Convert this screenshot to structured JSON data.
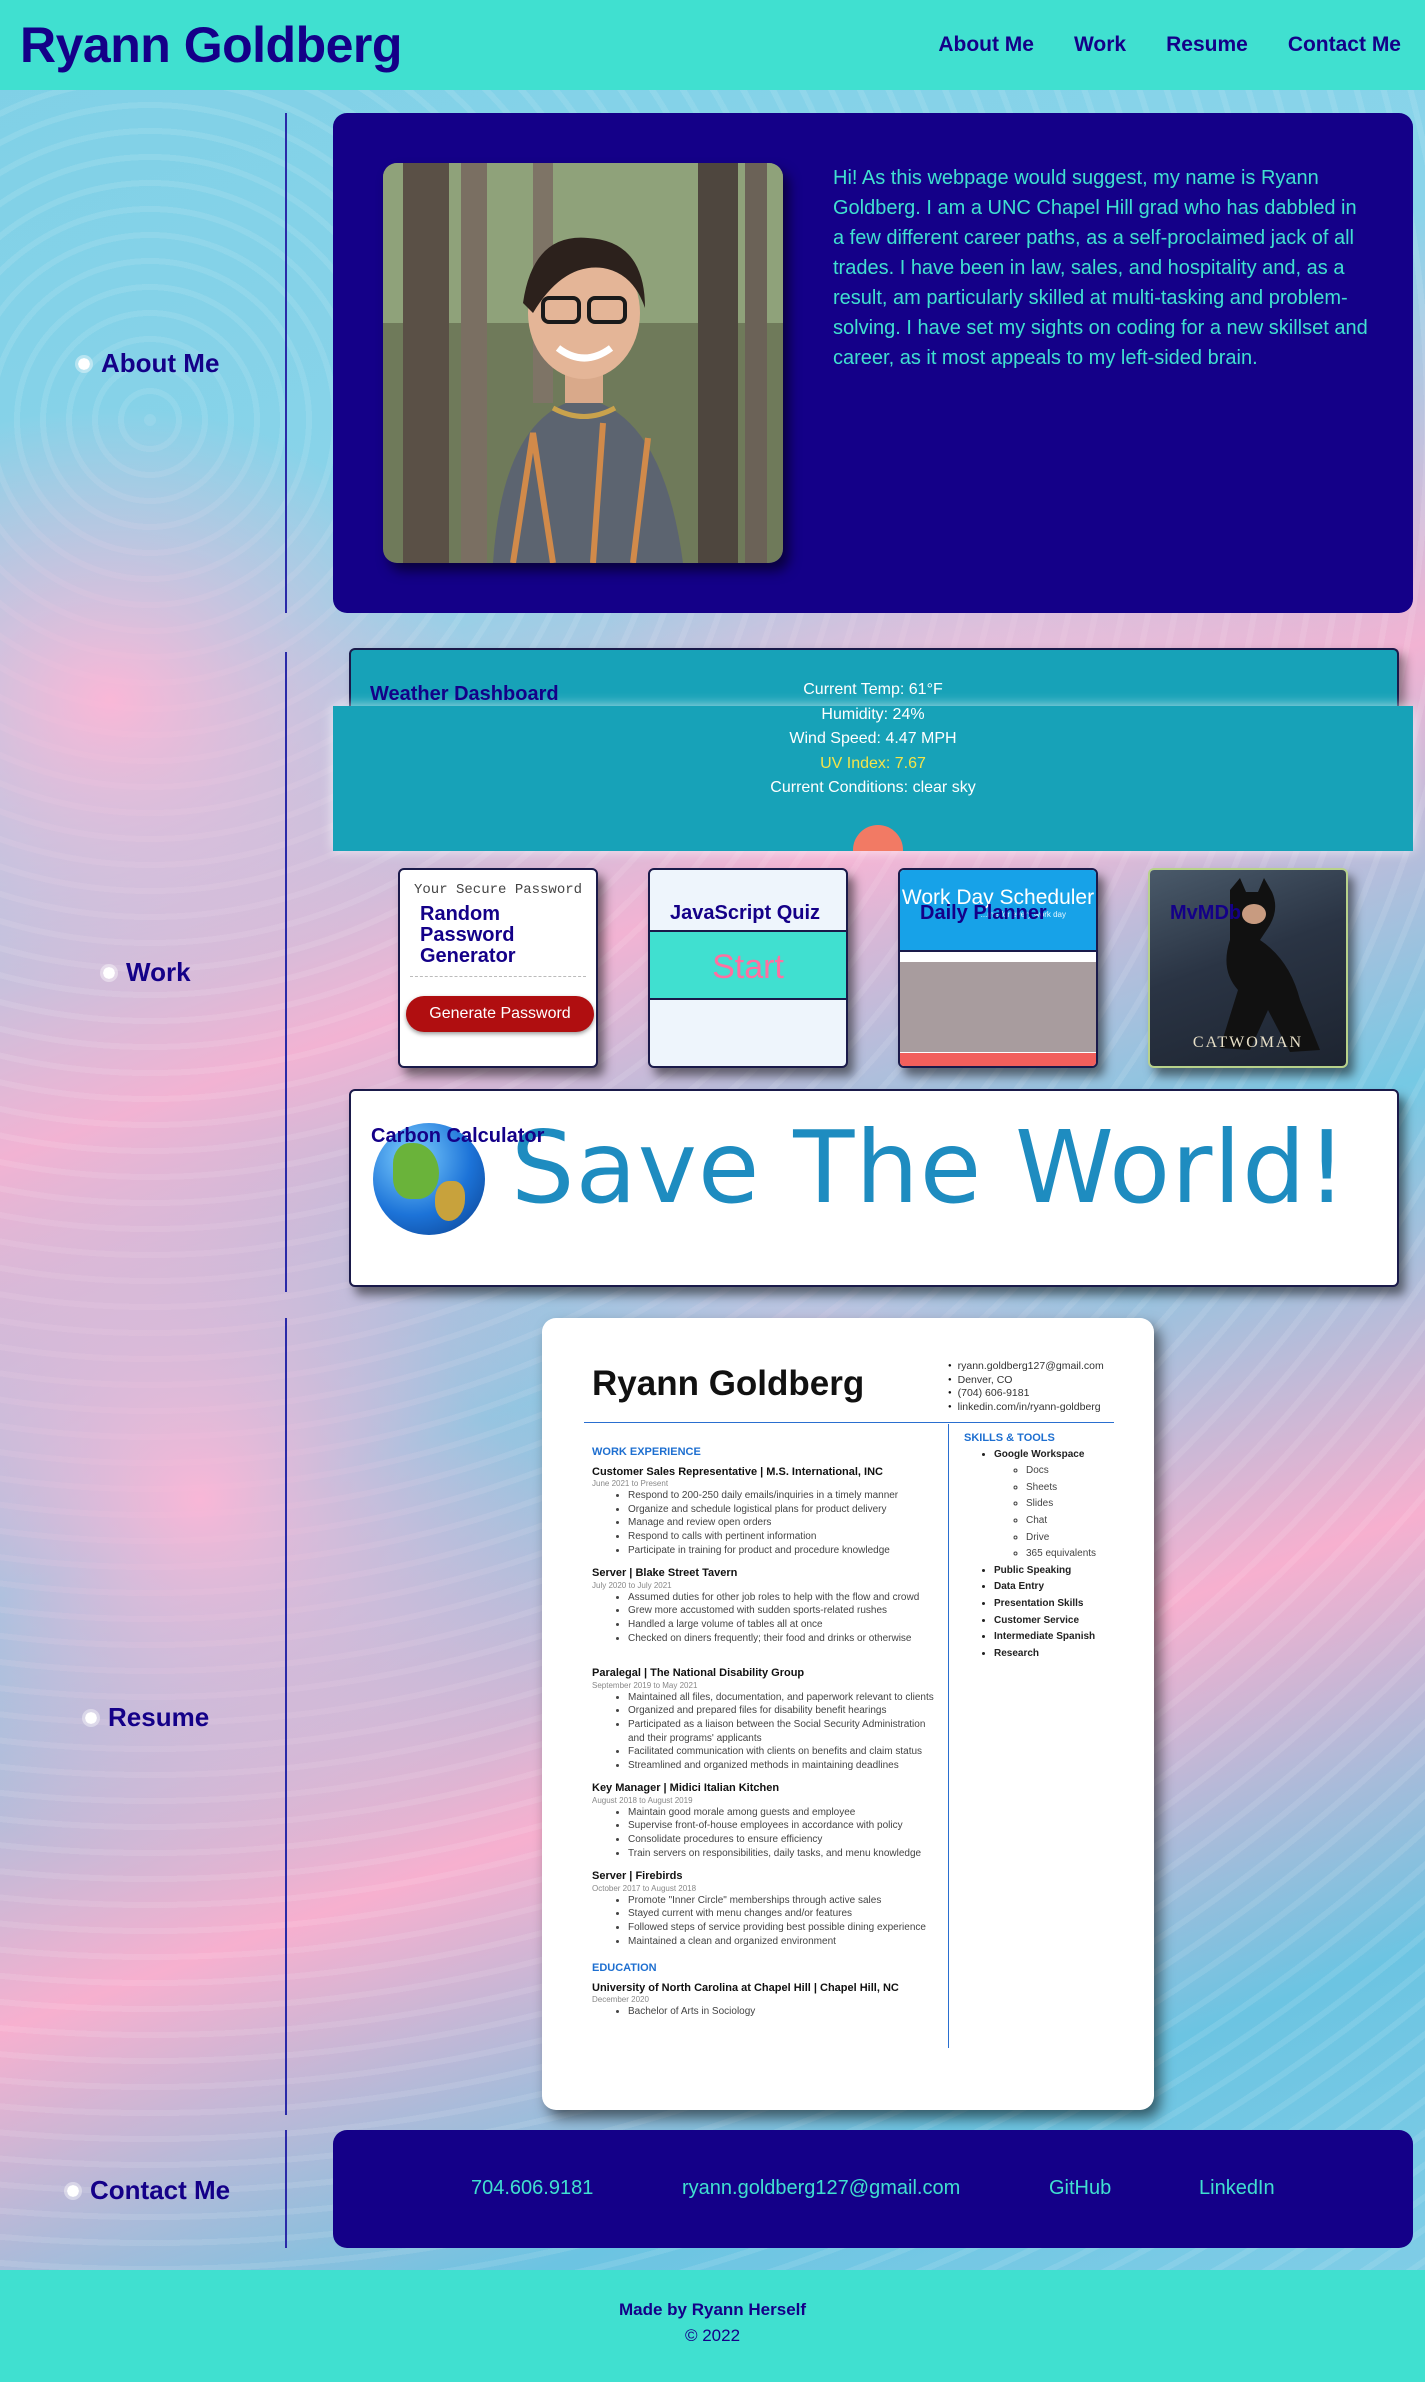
{
  "header": {
    "title": "Ryann Goldberg",
    "nav": [
      "About Me",
      "Work",
      "Resume",
      "Contact Me"
    ]
  },
  "sections": {
    "about": "About Me",
    "work": "Work",
    "resume": "Resume",
    "contact": "Contact Me"
  },
  "about": {
    "bio": "Hi! As this webpage would suggest, my name is Ryann Goldberg. I am a UNC Chapel Hill grad who has dabbled in a few different career paths, as a self-proclaimed jack of all trades. I have been in law, sales, and hospitality and, as a result, am particularly skilled at multi-tasking and problem-solving. I have set my sights on coding for a new skillset and career, as it most appeals to my left-sided brain."
  },
  "work": {
    "weather": {
      "title": "Weather Dashboard",
      "temp": "Current Temp: 61°F",
      "humidity": "Humidity: 24%",
      "wind": "Wind Speed: 4.47 MPH",
      "uv": "UV Index: 7.67",
      "conditions": "Current Conditions: clear sky"
    },
    "password": {
      "header": "Your Secure Password",
      "title": "Random Password Generator",
      "button": "Generate Password"
    },
    "quiz": {
      "title": "JavaScript Quiz",
      "start": "Start"
    },
    "planner": {
      "title": "Daily Planner",
      "banner": "Work Day Scheduler",
      "sub": "...me for every work day"
    },
    "movie": {
      "title": "MvMDb",
      "poster_text": "CATWOMAN"
    },
    "carbon": {
      "title": "Carbon Calculator",
      "slogan": "Save The World!"
    }
  },
  "resume": {
    "name": "Ryann Goldberg",
    "contact": [
      "ryann.goldberg127@gmail.com",
      "Denver, CO",
      "(704) 606-9181",
      "linkedin.com/in/ryann-goldberg"
    ],
    "work_heading": "WORK EXPERIENCE",
    "jobs": [
      {
        "title": "Customer Sales Representative | M.S. International, INC",
        "date": "June 2021 to Present",
        "bullets": [
          "Respond to 200-250 daily emails/inquiries in a timely manner",
          "Organize and schedule logistical plans for product delivery",
          "Manage and review open orders",
          "Respond to calls with pertinent information",
          "Participate in training for product and procedure knowledge"
        ]
      },
      {
        "title": "Server | Blake Street Tavern",
        "date": "July 2020 to July 2021",
        "bullets": [
          "Assumed duties for other job roles to help with the flow and crowd",
          "Grew more accustomed with sudden sports-related rushes",
          "Handled a large volume of tables all at once",
          "Checked on diners frequently; their food and drinks or otherwise"
        ]
      },
      {
        "title": "Paralegal | The National Disability Group",
        "date": "September 2019 to May 2021",
        "bullets": [
          "Maintained all files, documentation, and paperwork relevant to clients",
          "Organized and prepared files for disability benefit hearings",
          "Participated as a liaison between the Social Security Administration and their programs' applicants",
          "Facilitated communication with clients on benefits and claim status",
          "Streamlined and organized methods in maintaining deadlines"
        ]
      },
      {
        "title": "Key Manager | Midici Italian Kitchen",
        "date": "August 2018 to August 2019",
        "bullets": [
          "Maintain good morale among guests and employee",
          "Supervise front-of-house employees in accordance with policy",
          "Consolidate procedures to ensure efficiency",
          "Train servers on responsibilities, daily tasks, and menu knowledge"
        ]
      },
      {
        "title": "Server | Firebirds",
        "date": "October 2017 to August 2018",
        "bullets": [
          "Promote \"Inner Circle\" memberships through active sales",
          "Stayed current with menu changes and/or features",
          "Followed steps of service providing best possible dining experience",
          "Maintained a clean and organized environment"
        ]
      }
    ],
    "edu_heading": "EDUCATION",
    "edu": {
      "school": "University of North Carolina at Chapel Hill | Chapel Hill, NC",
      "date": "December 2020",
      "degree": "Bachelor of Arts in Sociology"
    },
    "skills_heading": "SKILLS & TOOLS",
    "skills_top": "Google Workspace",
    "skills_sub": [
      "Docs",
      "Sheets",
      "Slides",
      "Chat",
      "Drive",
      "365 equivalents"
    ],
    "skills_more": [
      "Public Speaking",
      "Data Entry",
      "Presentation Skills",
      "Customer Service",
      "Intermediate Spanish",
      "Research"
    ]
  },
  "contact": {
    "phone": "704.606.9181",
    "email": "ryann.goldberg127@gmail.com",
    "github": "GitHub",
    "linkedin": "LinkedIn"
  },
  "footer": {
    "made": "Made by Ryann Herself",
    "copy": "© 2022"
  },
  "colors": {
    "accent": "#40e0d0",
    "navy": "#140088",
    "weather": "#17a2b8"
  }
}
